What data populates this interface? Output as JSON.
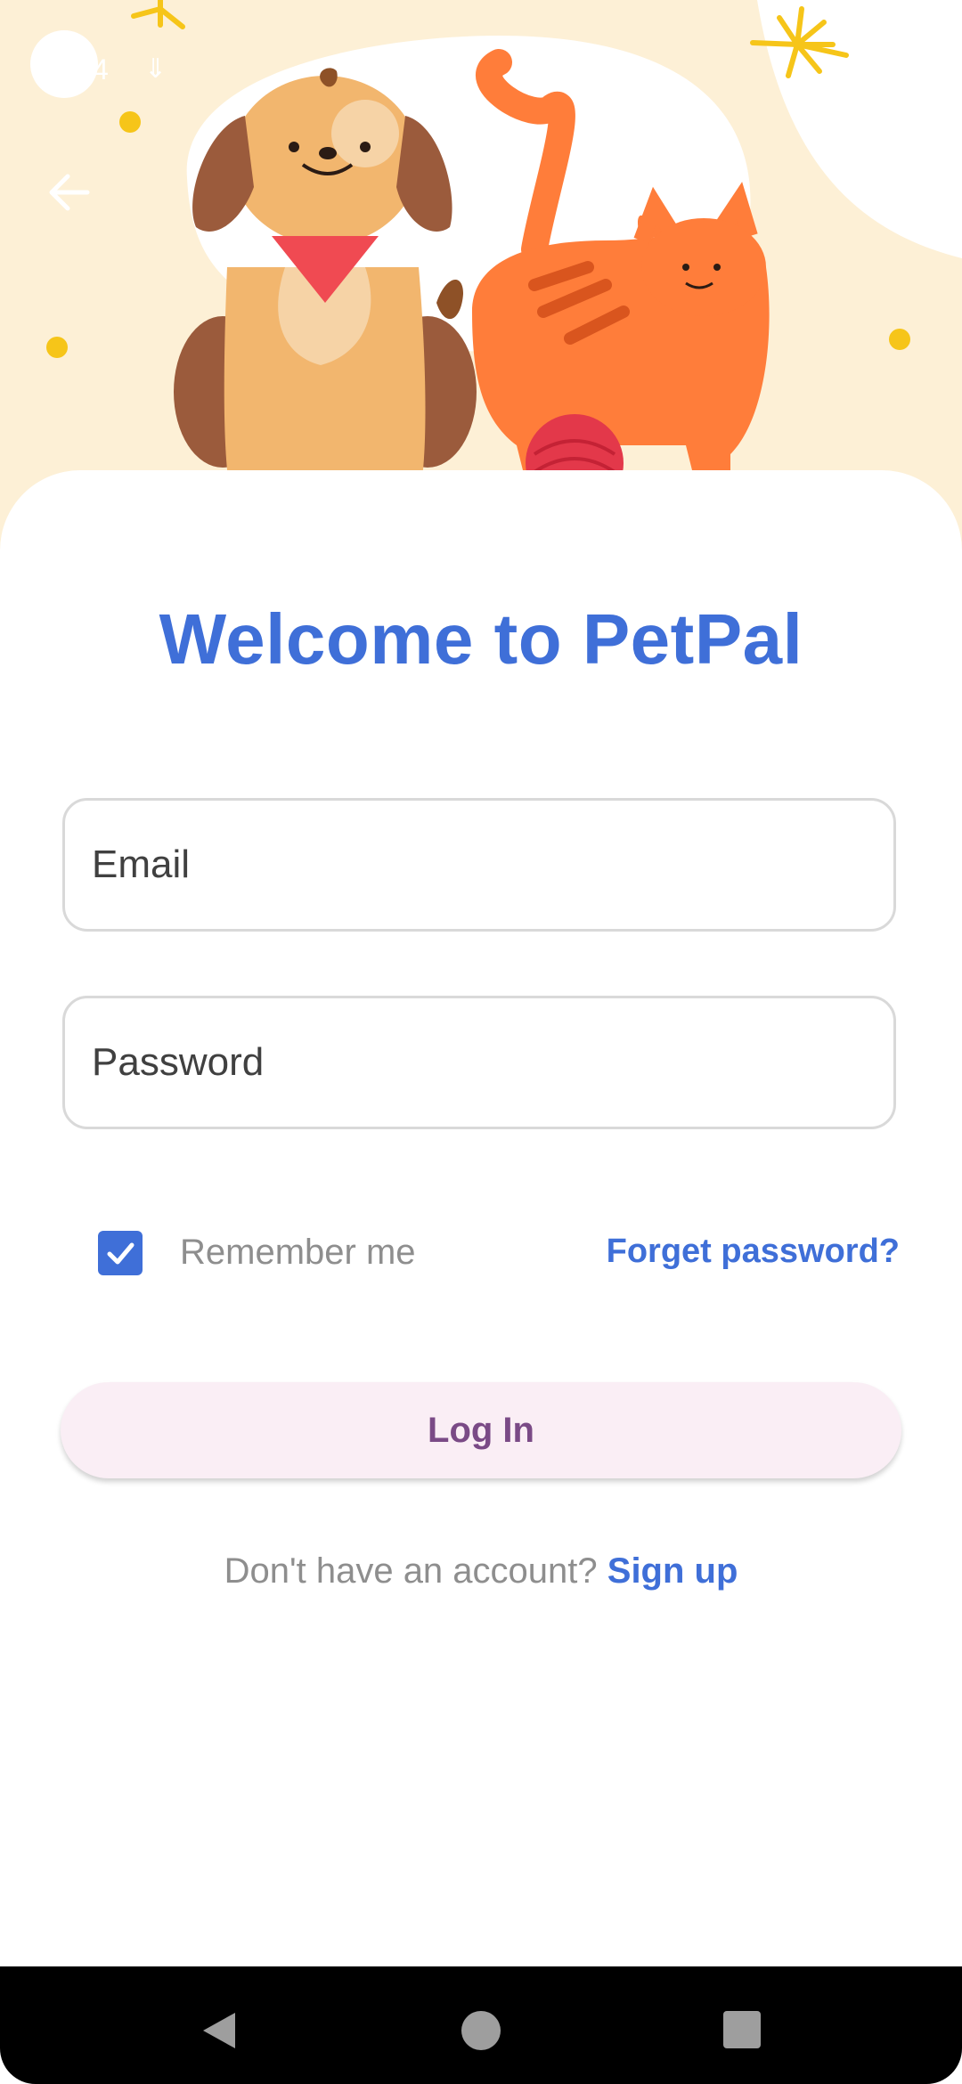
{
  "status_bar": {
    "text": "4",
    "icon": "download-arrow-icon"
  },
  "header": {
    "back_icon": "arrow-left-icon",
    "illustration": "dog-and-cat-illustration"
  },
  "title": "Welcome to PetPal",
  "form": {
    "email_placeholder": "Email",
    "email_value": "",
    "password_placeholder": "Password",
    "password_value": "",
    "remember_me_label": "Remember me",
    "remember_me_checked": true,
    "forgot_password_label": "Forget password?",
    "login_label": "Log In"
  },
  "signup": {
    "prompt": "Don't have an account?",
    "link": "Sign up"
  },
  "nav_bar": {
    "back_icon": "triangle-back-icon",
    "home_icon": "circle-home-icon",
    "recents_icon": "square-recents-icon"
  },
  "colors": {
    "accent": "#3F6FD8",
    "hero_background": "#FDF0D6",
    "login_button_bg": "#FAEEF5",
    "login_button_text": "#7A4A86",
    "muted_text": "#8E8E8E"
  }
}
